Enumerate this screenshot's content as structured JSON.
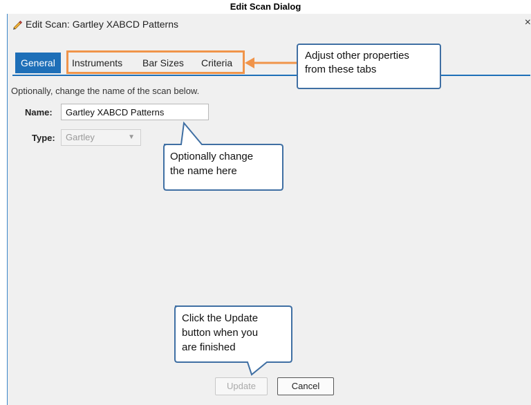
{
  "caption": "Edit Scan Dialog",
  "dialog": {
    "title": "Edit Scan: Gartley XABCD Patterns",
    "close_label": "×"
  },
  "tabs": [
    {
      "label": "General",
      "active": true
    },
    {
      "label": "Instruments",
      "active": false
    },
    {
      "label": "Bar Sizes",
      "active": false
    },
    {
      "label": "Criteria",
      "active": false
    }
  ],
  "general": {
    "description": "Optionally, change the name of the scan below.",
    "name_label": "Name:",
    "name_value": "Gartley XABCD Patterns",
    "type_label": "Type:",
    "type_value": "Gartley"
  },
  "buttons": {
    "update": "Update",
    "cancel": "Cancel"
  },
  "callouts": {
    "tabs_line1": "Adjust other properties",
    "tabs_line2": "from these tabs",
    "name_line1": "Optionally change",
    "name_line2": "the name here",
    "update_line1": "Click the Update",
    "update_line2": "button when you",
    "update_line3": "are finished"
  },
  "colors": {
    "accent": "#1e6fb8",
    "highlight": "#f0944a",
    "callout_border": "#3f6fa3"
  },
  "icons": {
    "title": "pencil-icon",
    "type_dropdown": "chevron-down-icon"
  }
}
